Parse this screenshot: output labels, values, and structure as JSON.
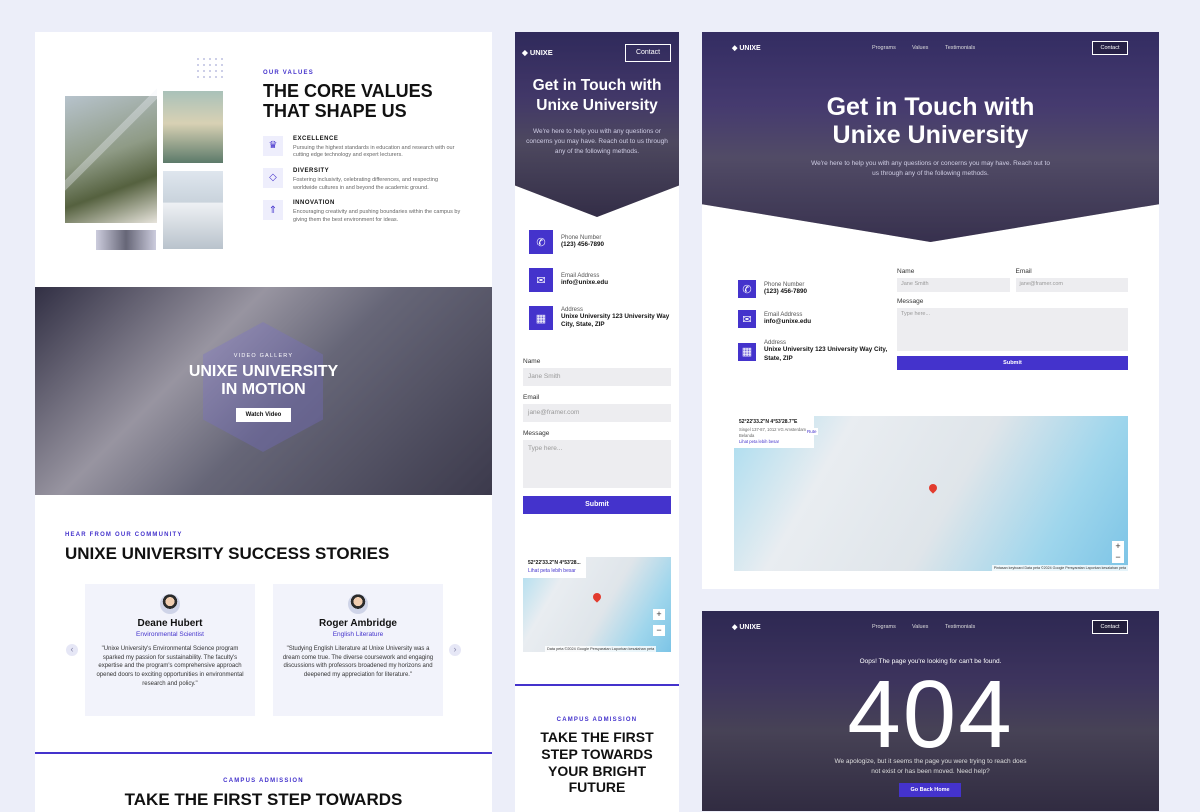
{
  "values_section": {
    "eyebrow": "OUR VALUES",
    "title_line1": "THE CORE VALUES",
    "title_line2": "THAT SHAPE US",
    "items": [
      {
        "icon": "trophy-icon",
        "glyph": "♛",
        "title": "EXCELLENCE",
        "desc": "Pursuing the highest standards in education and research with our cutting edge technology and expert lecturers."
      },
      {
        "icon": "shapes-icon",
        "glyph": "◇",
        "title": "DIVERSITY",
        "desc": "Fostering inclusivity, celebrating differences, and respecting worldwide cultures in and beyond the academic ground."
      },
      {
        "icon": "rocket-icon",
        "glyph": "⇑",
        "title": "INNOVATION",
        "desc": "Encouraging creativity and pushing boundaries within the campus by giving them the best environment for ideas."
      }
    ]
  },
  "video_section": {
    "eyebrow": "VIDEO GALLERY",
    "title_line1": "UNIXE UNIVERSITY",
    "title_line2": "IN MOTION",
    "button": "Watch Video"
  },
  "stories_section": {
    "eyebrow": "HEAR FROM OUR COMMUNITY",
    "title": "UNIXE UNIVERSITY SUCCESS STORIES",
    "cards": [
      {
        "name": "Deane Hubert",
        "role": "Environmental Scientist",
        "quote": "\"Unixe University's Environmental Science program sparked my passion for sustainability. The faculty's expertise and the program's comprehensive approach opened doors to exciting opportunities in environmental research and policy.\""
      },
      {
        "name": "Roger Ambridge",
        "role": "English Literature",
        "quote": "\"Studying English Literature at Unixe University was a dream come true. The diverse coursework and engaging discussions with professors broadened my horizons and deepened my appreciation for literature.\""
      }
    ],
    "prev_arrow": "‹",
    "next_arrow": "›"
  },
  "admission_bottom": {
    "eyebrow": "CAMPUS ADMISSION",
    "title": "TAKE THE FIRST STEP TOWARDS"
  },
  "brand": {
    "logo_text": "UNIXE"
  },
  "mobile": {
    "contact_button": "Contact",
    "hero_title_line1": "Get in Touch with",
    "hero_title_line2": "Unixe University",
    "hero_subtitle": "We're here to help you with any questions or concerns you may have. Reach out to us through any of the following methods.",
    "contacts": [
      {
        "icon": "phone-icon",
        "glyph": "✆",
        "label": "Phone Number",
        "value": "(123) 456-7890"
      },
      {
        "icon": "mail-icon",
        "glyph": "✉",
        "label": "Email Address",
        "value": "info@unixe.edu"
      },
      {
        "icon": "map-icon",
        "glyph": "▦",
        "label": "Address",
        "value": "Unixe University 123 University Way City, State, ZIP"
      }
    ],
    "form": {
      "name_label": "Name",
      "name_placeholder": "Jane Smith",
      "email_label": "Email",
      "email_placeholder": "jane@framer.com",
      "message_label": "Message",
      "message_placeholder": "Type here...",
      "submit": "Submit"
    },
    "map": {
      "coords": "52°22'33.2\"N 4°53'28...",
      "link": "Lihat peta lebih besar",
      "footer": "Data peta ©2024 Google   Persyaratan   Laporkan kesalahan peta"
    },
    "admission_eyebrow": "CAMPUS ADMISSION",
    "admission_title": "TAKE THE FIRST STEP TOWARDS YOUR BRIGHT FUTURE"
  },
  "desktop": {
    "nav": [
      "Programs",
      "Values",
      "Testimonials"
    ],
    "contact_button": "Contact",
    "hero_title_line1": "Get in Touch with",
    "hero_title_line2": "Unixe University",
    "hero_subtitle": "We're here to help you with any questions or concerns you may have. Reach out to us through any of the following methods.",
    "contacts": [
      {
        "icon": "phone-icon",
        "glyph": "✆",
        "label": "Phone Number",
        "value": "(123) 456-7890"
      },
      {
        "icon": "mail-icon",
        "glyph": "✉",
        "label": "Email Address",
        "value": "info@unixe.edu"
      },
      {
        "icon": "map-icon",
        "glyph": "▦",
        "label": "Address",
        "value": "Unixe University 123 University Way City, State, ZIP"
      }
    ],
    "form": {
      "name_label": "Name",
      "name_placeholder": "Jane Smith",
      "email_label": "Email",
      "email_placeholder": "jane@framer.com",
      "message_label": "Message",
      "message_placeholder": "Type here...",
      "submit": "Submit"
    },
    "map": {
      "coords": "52°22'33.2\"N 4°53'28.7\"E",
      "address": "Singel 137-87, 1012 VG Amsterdam, Belanda",
      "link": "Lihat peta lebih besar",
      "route": "Rute",
      "footer": "Pintasan keyboard   Data peta ©2024 Google   Persyaratan   Laporkan kesalahan peta"
    }
  },
  "error_page": {
    "nav": [
      "Programs",
      "Values",
      "Testimonials"
    ],
    "contact_button": "Contact",
    "oops": "Oops! The page you're looking for can't be found.",
    "code": "404",
    "message": "We apologize, but it seems the page you were trying to reach does not exist or has been moved. Need help?",
    "button": "Go Back Home"
  },
  "colors": {
    "accent": "#4433cc",
    "background": "#eceef9"
  }
}
